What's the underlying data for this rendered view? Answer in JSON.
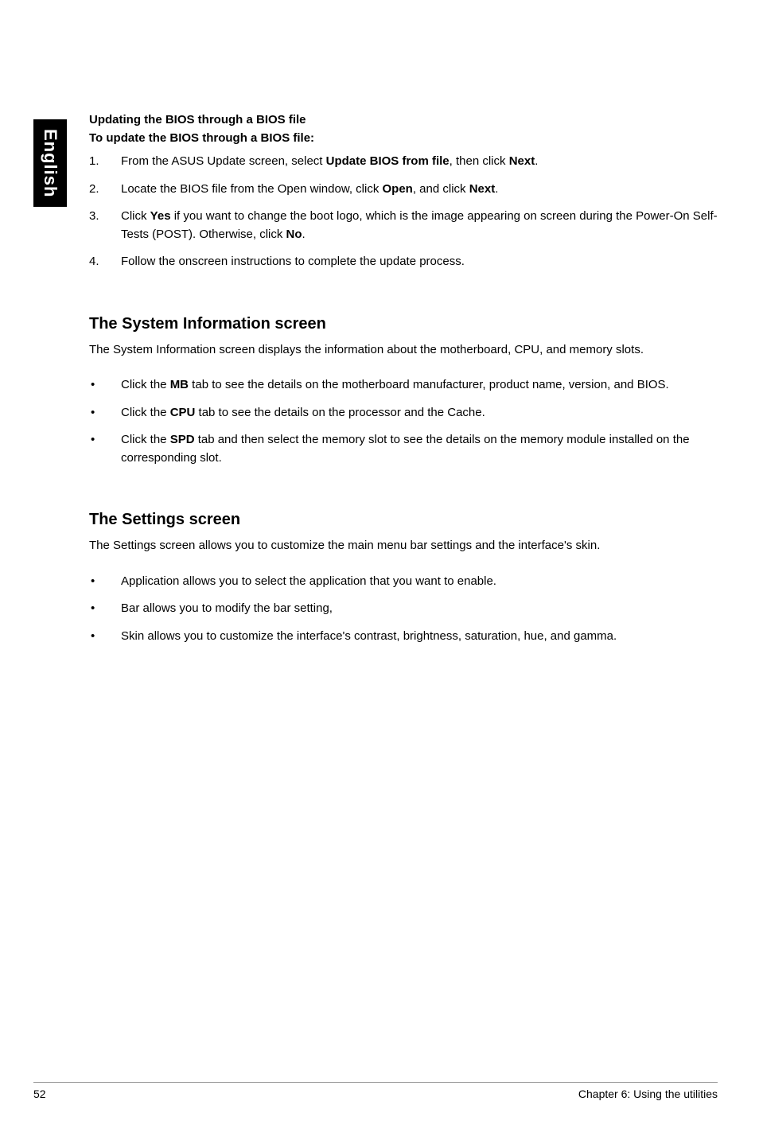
{
  "sidebar": {
    "label": "English"
  },
  "section1": {
    "heading1": "Updating the BIOS through a BIOS file",
    "heading2": "To update the BIOS through a BIOS file:",
    "items": [
      {
        "num": "1.",
        "pre": "From the ASUS Update screen, select ",
        "b1": "Update BIOS from file",
        "mid": ", then click ",
        "b2": "Next",
        "post": "."
      },
      {
        "num": "2.",
        "pre": "Locate the BIOS file from the Open window, click ",
        "b1": "Open",
        "mid": ", and click ",
        "b2": "Next",
        "post": "."
      },
      {
        "num": "3.",
        "pre": "Click ",
        "b1": "Yes",
        "mid": " if you want to change the boot logo, which is the image appearing on screen during the Power-On Self-Tests (POST). Otherwise, click ",
        "b2": "No",
        "post": "."
      },
      {
        "num": "4.",
        "pre": "Follow the onscreen instructions to complete the update process.",
        "b1": "",
        "mid": "",
        "b2": "",
        "post": ""
      }
    ]
  },
  "section2": {
    "title": "The System Information screen",
    "desc": "The System Information screen displays the information about the motherboard, CPU, and memory slots.",
    "items": [
      {
        "pre": "Click the ",
        "b": "MB",
        "post": " tab to see the details on the motherboard manufacturer, product name, version, and BIOS."
      },
      {
        "pre": "Click the ",
        "b": "CPU",
        "post": " tab to see the details on the processor and the Cache."
      },
      {
        "pre": "Click the ",
        "b": "SPD",
        "post": " tab and then select the memory slot to see the details on the memory module installed on the corresponding slot."
      }
    ]
  },
  "section3": {
    "title": "The Settings screen",
    "desc": "The Settings screen allows you to customize the main menu bar settings and the interface's skin.",
    "items": [
      {
        "text": "Application allows you to select the application that you want to enable."
      },
      {
        "text": "Bar allows you to modify the bar setting,"
      },
      {
        "text": "Skin allows you to customize the interface's contrast, brightness, saturation, hue, and gamma."
      }
    ]
  },
  "footer": {
    "page": "52",
    "chapter": "Chapter 6: Using the utilities"
  }
}
